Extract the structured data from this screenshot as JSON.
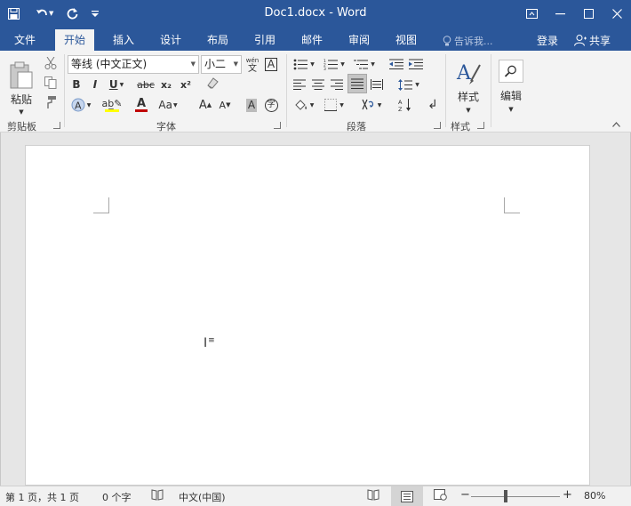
{
  "app": {
    "title": "Doc1.docx - Word"
  },
  "tabs": [
    {
      "label": "文件"
    },
    {
      "label": "开始"
    },
    {
      "label": "插入"
    },
    {
      "label": "设计"
    },
    {
      "label": "布局"
    },
    {
      "label": "引用"
    },
    {
      "label": "邮件"
    },
    {
      "label": "审阅"
    },
    {
      "label": "视图"
    }
  ],
  "header": {
    "tell_me": "告诉我...",
    "login": "登录",
    "share": "共享"
  },
  "ribbon": {
    "clipboard": {
      "paste_label": "粘贴",
      "group_label": "剪贴板"
    },
    "font": {
      "font_name": "等线 (中文正文)",
      "font_size": "小二",
      "group_label": "字体",
      "bold": "B",
      "italic": "I",
      "underline": "U",
      "strike": "abc",
      "subscript": "x₂",
      "superscript": "x²",
      "change_case": "Aa",
      "grow": "A",
      "shrink": "A",
      "clear_fmt": "A",
      "wen": "wén",
      "char_border": "A",
      "font_color": "A",
      "highlight": "A",
      "char_shading": "A",
      "enclose": "字"
    },
    "paragraph": {
      "group_label": "段落"
    },
    "styles": {
      "styles_label": "样式",
      "group_label": "样式"
    },
    "editing": {
      "editing_label": "编辑"
    }
  },
  "status": {
    "page": "第 1 页，共 1 页",
    "words": "0 个字",
    "lang": "中文(中国)",
    "zoom": "80%",
    "zoom_level": 0.8
  },
  "colors": {
    "accent": "#2b579a",
    "font_color_bar": "#c00000",
    "highlight_bar": "#ffff00"
  }
}
